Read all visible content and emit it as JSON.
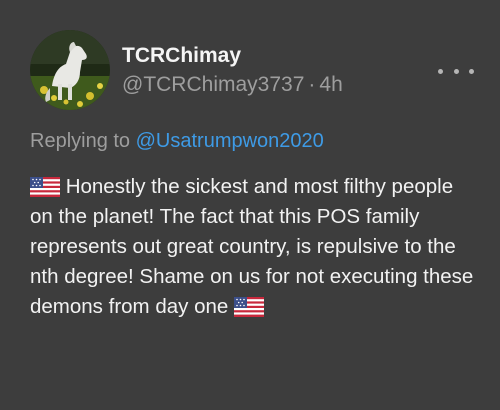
{
  "tweet": {
    "display_name": "TCRChimay",
    "handle": "@TCRChimay3737",
    "separator": "·",
    "time_ago": "4h",
    "replying_prefix": "Replying to",
    "replying_to": "@Usatrumpwon2020",
    "body_main": "Honestly the sickest and most filthy people on the planet! The fact that this POS family represents out great country, is repulsive to the nth degree! Shame on us for not executing these demons from day one",
    "flag_icon": "us-flag-icon",
    "more_icon": "more-horizontal-icon"
  },
  "colors": {
    "background": "#3d3d3d",
    "text_primary": "#f2f2f2",
    "text_secondary": "#9e9e9e",
    "link": "#3e9be6"
  }
}
